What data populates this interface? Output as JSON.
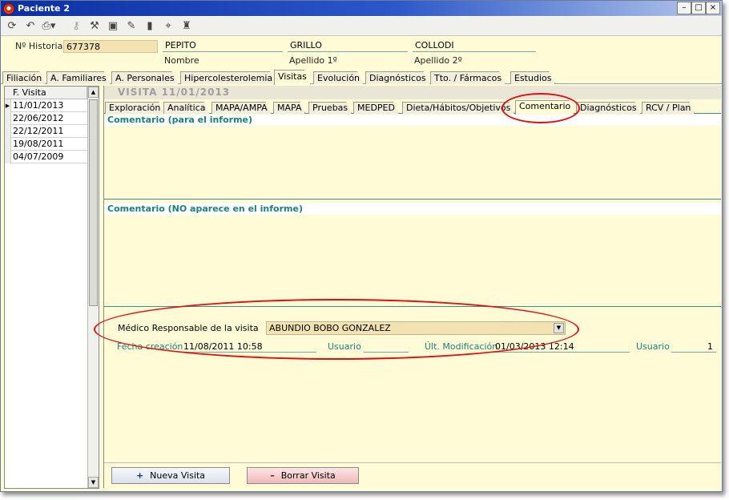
{
  "window": {
    "title": "Paciente 2"
  },
  "toolbar": {
    "icons": [
      "refresh-icon",
      "undo-icon",
      "print-icon",
      "key-icon",
      "tools-icon",
      "save-icon",
      "edit-icon",
      "delete-icon",
      "chart-icon",
      "chair-icon"
    ]
  },
  "patient": {
    "historia_label": "Nº Historia",
    "historia_value": "677378",
    "nombre_value": "PEPITO",
    "nombre_label": "Nombre",
    "apellido1_value": "GRILLO",
    "apellido1_label": "Apellido 1º",
    "apellido2_value": "COLLODI",
    "apellido2_label": "Apellido 2º"
  },
  "main_tabs": [
    "Filiación",
    "A. Familiares",
    "A. Personales",
    "Hipercolesterolemia",
    "Visitas",
    "Evolución",
    "Diagnósticos",
    "Tto. / Fármacos",
    "Estudios"
  ],
  "main_tab_active": "Visitas",
  "visit_list": {
    "header": "F. Visita",
    "rows": [
      "11/01/2013",
      "22/06/2012",
      "22/12/2011",
      "19/08/2011",
      "04/07/2009"
    ],
    "selected": "11/01/2013"
  },
  "visit_title": "VISITA  11/01/2013",
  "sub_tabs": [
    "Exploración",
    "Analítica",
    "MAPA/AMPA",
    "MAPA",
    "Pruebas",
    "MEDPED",
    "Dieta/Hábitos/Objetivos",
    "Comentario",
    "Diagnósticos",
    "RCV / Plan"
  ],
  "sub_tab_active": "Comentario",
  "comments": {
    "report_label": "Comentario (para el informe)",
    "report_text": "",
    "private_label": "Comentario (NO aparece en el informe)",
    "private_text": ""
  },
  "doctor": {
    "label": "Médico Responsable de la visita",
    "value": "ABUNDIO BOBO GONZALEZ"
  },
  "meta": {
    "created_label": "Fecha creación",
    "created_value": "11/08/2011 10:58",
    "user_label": "Usuario",
    "user_value": "",
    "modified_label": "Últ. Modificación",
    "modified_value": "01/03/2013 12:14",
    "user2_label": "Usuario",
    "user2_value": "1"
  },
  "buttons": {
    "new_visit": "Nueva Visita",
    "delete_visit": "Borrar Visita"
  },
  "colors": {
    "annotation_ring": "#e01010",
    "panel_bg": "#fffbd6",
    "teal_text": "#1e7f7b"
  }
}
